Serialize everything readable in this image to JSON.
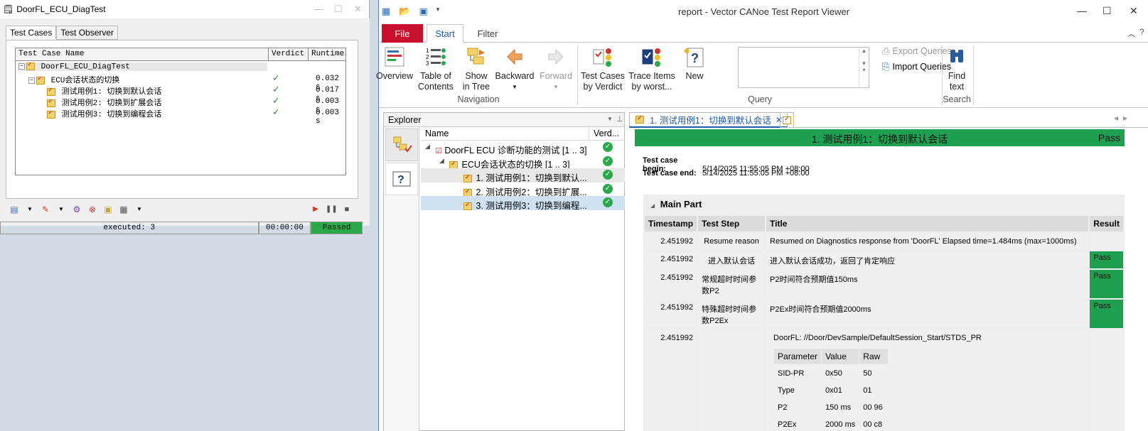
{
  "left_window": {
    "title": "DoorFL_ECU_DiagTest",
    "tabs": [
      "Test Cases",
      "Test Observer"
    ],
    "columns": [
      "Test Case Name",
      "Verdict",
      "Runtime"
    ],
    "rows": [
      {
        "name": "DoorFL_ECU_DiagTest",
        "verdict": "",
        "runtime": ""
      },
      {
        "name": "ECU会话状态的切换",
        "verdict": "✓",
        "runtime": "0.032 s"
      },
      {
        "name": "测试用例1: 切换到默认会话",
        "verdict": "✓",
        "runtime": "0.017 s"
      },
      {
        "name": "测试用例2: 切换到扩展会话",
        "verdict": "✓",
        "runtime": "0.003 s"
      },
      {
        "name": "测试用例3: 切换到编程会话",
        "verdict": "✓",
        "runtime": "0.003 s"
      }
    ],
    "status": {
      "executed": "executed: 3",
      "time": "00:00:00",
      "result": "Passed"
    }
  },
  "right_window": {
    "title": "report - Vector CANoe Test Report Viewer",
    "ribbon_tabs": {
      "file": "File",
      "start": "Start",
      "filter": "Filter"
    },
    "ribbon": {
      "overview": "Overview",
      "toc1": "Table of",
      "toc2": "Contents",
      "show1": "Show",
      "show2": "in Tree",
      "backward": "Backward",
      "forward": "Forward",
      "tcv1": "Test Cases",
      "tcv2": "by Verdict",
      "trace1": "Trace Items",
      "trace2": "by worst...",
      "new": "New",
      "export_queries": "Export Queries",
      "import_queries": "Import Queries",
      "find1": "Find",
      "find2": "text",
      "group_navigation": "Navigation",
      "group_query": "Query",
      "group_search": "Search"
    },
    "explorer": {
      "title": "Explorer",
      "columns": [
        "Name",
        "Verd..."
      ],
      "items": [
        "DoorFL ECU 诊断功能的测试 [1 .. 3]",
        "ECU会话状态的切换 [1 .. 3]",
        "1. 测试用例1：切换到默认...",
        "2. 测试用例2：切换到扩展...",
        "3. 测试用例3：切换到编程..."
      ]
    },
    "doc": {
      "tab_title": "1. 测试用例1：切换到默认会话",
      "banner_title": "1. 测试用例1：切换到默认会话",
      "banner_verdict": "Pass",
      "begin_label": "Test case begin:",
      "begin_value": "5/14/2025 11:55:05 PM +08:00",
      "end_label": "Test case end:",
      "end_value": "5/14/2025 11:55:05 PM +08:00",
      "main_part": "Main Part",
      "columns": [
        "Timestamp",
        "Test Step",
        "Title",
        "Result"
      ],
      "rows": [
        {
          "ts": "2.451992",
          "step": "Resume reason",
          "title": "Resumed on Diagnostics response from 'DoorFL' Elapsed time=1.484ms (max=1000ms)",
          "result": ""
        },
        {
          "ts": "2.451992",
          "step": "进入默认会话",
          "title": "进入默认会话成功，返回了肯定响应",
          "result": "Pass"
        },
        {
          "ts": "2.451992",
          "step": "常规超时时间参数P2",
          "title": "P2时间符合预期值150ms",
          "result": "Pass"
        },
        {
          "ts": "2.451992",
          "step": "特殊超时时间参数P2Ex",
          "title": "P2Ex时间符合预期值2000ms",
          "result": "Pass"
        },
        {
          "ts": "2.451992",
          "step": "",
          "title": "",
          "result": ""
        }
      ],
      "diag": {
        "path": "DoorFL: //Door/DevSample/DefaultSession_Start/STDS_PR",
        "columns": [
          "Parameter",
          "Value",
          "Raw"
        ],
        "rows": [
          [
            "SID-PR",
            "0x50",
            "50"
          ],
          [
            "Type",
            "0x01",
            "01"
          ],
          [
            "P2",
            "150 ms",
            "00 96"
          ],
          [
            "P2Ex",
            "2000 ms",
            "00 c8"
          ]
        ]
      }
    }
  }
}
